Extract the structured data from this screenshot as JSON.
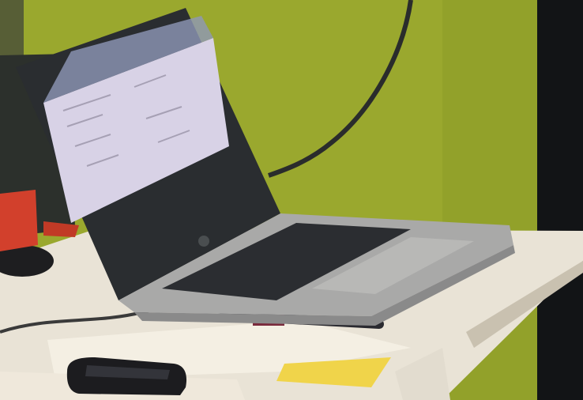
{
  "scene": {
    "description_free": true,
    "colors": {
      "wall": "#9aa82e",
      "wall_shadow": "#7f8c22",
      "curtain": "#121416",
      "table_top": "#e9e3d6",
      "table_edge": "#c9c1b0",
      "laptop_lid": "#2a2d30",
      "laptop_base": "#a9a9a8",
      "keyboard": "#2b2d31",
      "screen_glow": "#d8d2e6",
      "red_object": "#d2402c",
      "paper_yellow": "#f0d44a",
      "phone": "#1c1c1f"
    }
  }
}
